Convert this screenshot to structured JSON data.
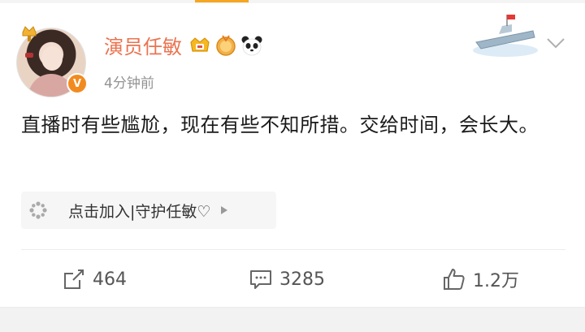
{
  "post": {
    "author_name": "演员任敏",
    "timestamp": "4分钟前",
    "verified_mark": "V",
    "content": "直播时有些尴尬，现在有些不知所措。交给时间，会长大。",
    "super_topic_label": "点击加入|守护任敏♡"
  },
  "actions": {
    "forward_count": "464",
    "comment_count": "3285",
    "like_count": "1.2万"
  },
  "colors": {
    "author_name": "#eb7350",
    "verified": "#f28b1f",
    "accent_tab": "#f5a623",
    "muted_text": "#939393"
  },
  "icons": [
    "crown-icon",
    "vip-crown-badge-icon",
    "medal-badge-icon",
    "panda-icon",
    "ship-decoration-icon",
    "chevron-down-icon",
    "super-topic-icon",
    "play-arrow-icon",
    "forward-icon",
    "comment-icon",
    "like-icon"
  ]
}
